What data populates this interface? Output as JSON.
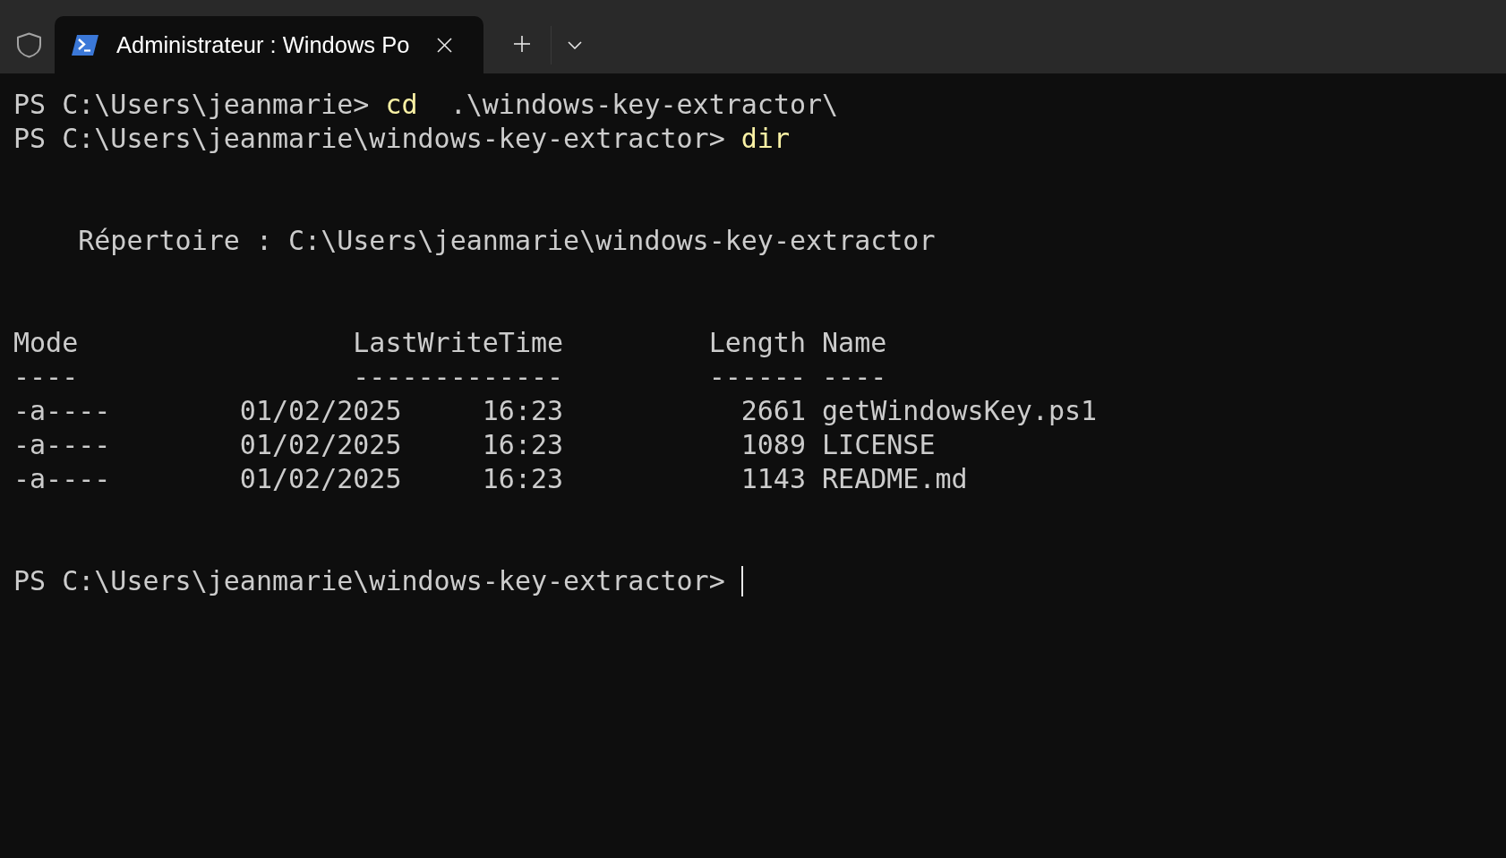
{
  "tab_bar": {
    "tabs": [
      {
        "title": "Administrateur : Windows Po",
        "selected": true
      }
    ]
  },
  "terminal": {
    "lines": [
      {
        "kind": "prompt",
        "prompt": "PS C:\\Users\\jeanmarie>",
        "command": "cd",
        "args": ".\\windows-key-extractor\\",
        "cursor": false
      },
      {
        "kind": "prompt",
        "prompt": "PS C:\\Users\\jeanmarie\\windows-key-extractor>",
        "command": "dir",
        "cursor": false
      },
      {
        "kind": "blank"
      },
      {
        "kind": "blank"
      },
      {
        "kind": "heading",
        "text": "Répertoire : C:\\Users\\jeanmarie\\windows-key-extractor"
      },
      {
        "kind": "blank"
      },
      {
        "kind": "blank"
      },
      {
        "kind": "table",
        "columns": [
          {
            "label": "Mode",
            "underline": "----"
          },
          {
            "label": "LastWriteTime",
            "underline": "-------------"
          },
          {
            "label": "Length",
            "underline": "------"
          },
          {
            "label": "Name",
            "underline": "----"
          }
        ],
        "rows": [
          {
            "mode": "-a----",
            "date": "01/02/2025",
            "time": "16:23",
            "length": "2661",
            "name": "getWindowsKey.ps1"
          },
          {
            "mode": "-a----",
            "date": "01/02/2025",
            "time": "16:23",
            "length": "1089",
            "name": "LICENSE"
          },
          {
            "mode": "-a----",
            "date": "01/02/2025",
            "time": "16:23",
            "length": "1143",
            "name": "README.md"
          }
        ]
      },
      {
        "kind": "blank"
      },
      {
        "kind": "blank"
      },
      {
        "kind": "prompt",
        "prompt": "PS C:\\Users\\jeanmarie\\windows-key-extractor>",
        "cursor": true
      }
    ]
  }
}
